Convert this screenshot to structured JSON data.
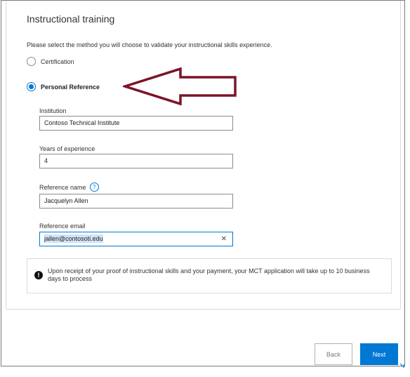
{
  "section": {
    "title": "Instructional training",
    "prompt": "Please select the method you will choose to validate your instructional skills experience."
  },
  "options": {
    "certification": {
      "label": "Certification",
      "selected": false
    },
    "personal_reference": {
      "label": "Personal Reference",
      "selected": true
    }
  },
  "fields": {
    "institution": {
      "label": "Institution",
      "value": "Contoso Technical Institute"
    },
    "years": {
      "label": "Years of experience",
      "value": "4"
    },
    "reference_name": {
      "label": "Reference name",
      "value": "Jacquelyn Allen",
      "help_icon": "question-circle-icon"
    },
    "reference_email": {
      "label": "Reference email",
      "value": "jallen@contosoti.edu",
      "clear_icon": "✕"
    }
  },
  "notice": {
    "icon": "!",
    "text": "Upon receipt of your proof of instructional skills and your payment, your MCT application will take up to 10 business days to process"
  },
  "buttons": {
    "back": "Back",
    "next": "Next"
  },
  "help_glyph": "?",
  "colors": {
    "accent": "#0078d4",
    "annotation_arrow": "#7b1428"
  }
}
